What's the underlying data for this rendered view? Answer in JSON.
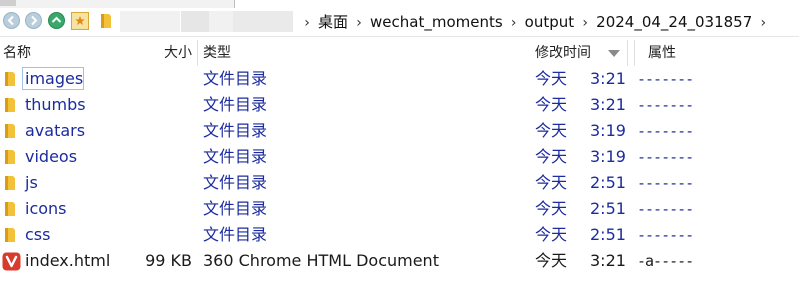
{
  "address_bar": {
    "crumbs": [
      "桌面",
      "wechat_moments",
      "output",
      "2024_04_24_031857"
    ],
    "separator": "›"
  },
  "columns": {
    "name": "名称",
    "size": "大小",
    "type": "类型",
    "date": "修改时间",
    "attr": "属性"
  },
  "files": [
    {
      "name": "images",
      "size": "",
      "type": "文件目录",
      "date": "今天",
      "time": "3:21",
      "attr": "-------",
      "kind": "folder"
    },
    {
      "name": "thumbs",
      "size": "",
      "type": "文件目录",
      "date": "今天",
      "time": "3:21",
      "attr": "-------",
      "kind": "folder"
    },
    {
      "name": "avatars",
      "size": "",
      "type": "文件目录",
      "date": "今天",
      "time": "3:19",
      "attr": "-------",
      "kind": "folder"
    },
    {
      "name": "videos",
      "size": "",
      "type": "文件目录",
      "date": "今天",
      "time": "3:19",
      "attr": "-------",
      "kind": "folder"
    },
    {
      "name": "js",
      "size": "",
      "type": "文件目录",
      "date": "今天",
      "time": "2:51",
      "attr": "-------",
      "kind": "folder"
    },
    {
      "name": "icons",
      "size": "",
      "type": "文件目录",
      "date": "今天",
      "time": "2:51",
      "attr": "-------",
      "kind": "folder"
    },
    {
      "name": "css",
      "size": "",
      "type": "文件目录",
      "date": "今天",
      "time": "2:51",
      "attr": "-------",
      "kind": "folder"
    },
    {
      "name": "index.html",
      "size": "99 KB",
      "type": "360 Chrome HTML Document",
      "date": "今天",
      "time": "3:21",
      "attr": "-a-----",
      "kind": "html"
    }
  ],
  "colors": {
    "folder_text": "#1c2b9e",
    "file_text": "#1a1a1a",
    "folder_icon": "#f3c13a",
    "html_icon": "#d83a2e"
  }
}
